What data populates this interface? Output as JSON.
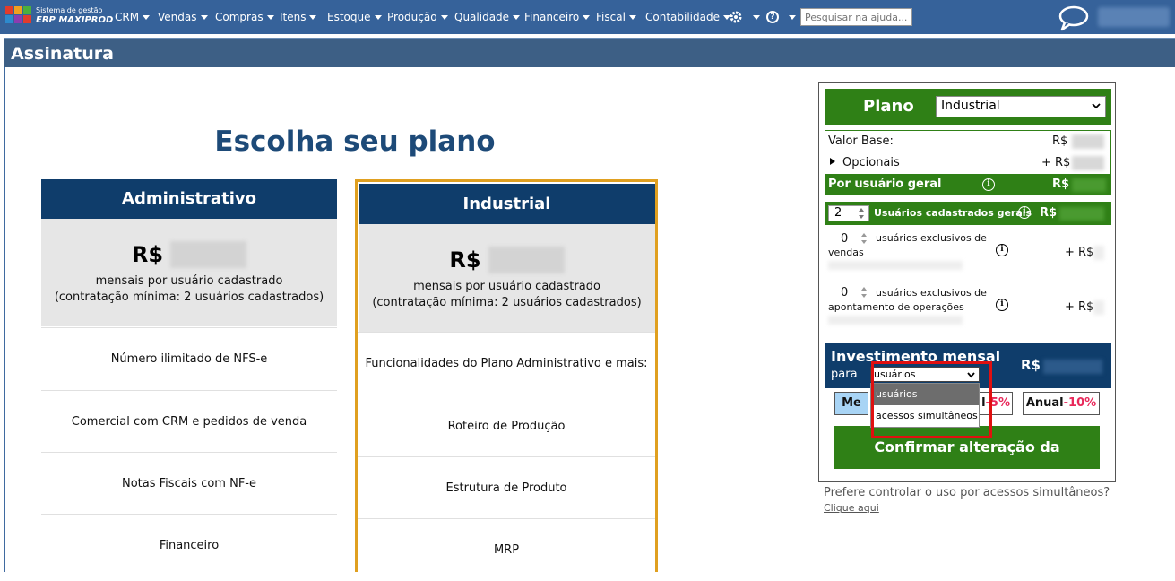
{
  "topbar": {
    "brand_line1": "Sistema de gestão",
    "brand_line2": "ERP MAXIPROD",
    "menu": [
      {
        "label": "CRM"
      },
      {
        "label": "Vendas"
      },
      {
        "label": "Compras"
      },
      {
        "label": "Itens"
      },
      {
        "label": "Estoque"
      },
      {
        "label": "Produção"
      },
      {
        "label": "Qualidade"
      },
      {
        "label": "Financeiro"
      },
      {
        "label": "Fiscal"
      },
      {
        "label": "Contabilidade"
      }
    ],
    "search_placeholder": "Pesquisar na ajuda...",
    "nav_color": "#36629a"
  },
  "page": {
    "title": "Assinatura",
    "heading": "Escolha seu plano"
  },
  "plans": [
    {
      "name": "Administrativo",
      "currency": "R$",
      "price_note_1": "mensais por usuário cadastrado",
      "price_note_2": "(contratação mínima: 2 usuários cadastrados)",
      "features": [
        "Número ilimitado de NFS-e",
        "Comercial com CRM e pedidos de venda",
        "Notas Fiscais com NF-e",
        "Financeiro"
      ]
    },
    {
      "name": "Industrial",
      "currency": "R$",
      "price_note_1": "mensais por usuário cadastrado",
      "price_note_2": "(contratação mínima: 2 usuários cadastrados)",
      "features": [
        "Funcionalidades do Plano Administrativo e mais:",
        "Roteiro de Produção",
        "Estrutura de Produto",
        "MRP"
      ]
    }
  ],
  "panel": {
    "plano_label": "Plano",
    "plano_value": "Industrial",
    "valor_base_label": "Valor Base:",
    "valor_base_currency": "R$",
    "opcionais_label": "Opcionais",
    "opcionais_currency": "+ R$",
    "por_usuario_label": "Por usuário geral",
    "por_usuario_currency": "R$",
    "usuarios_gerais_count": "2",
    "usuarios_gerais_label": "Usuários cadastrados gerais",
    "usuarios_gerais_currency": "R$",
    "vendas_count": "0",
    "vendas_label_1": "usuários exclusivos de",
    "vendas_label_2": "vendas",
    "vendas_currency": "+ R$",
    "apont_count": "0",
    "apont_label_1": "usuários exclusivos de",
    "apont_label_2": "apontamento de operações",
    "apont_currency": "+ R$",
    "invest_label": "Investimento mensal",
    "invest_para": "para",
    "invest_currency": "R$",
    "invest_select_value": "usuários cadastrados",
    "invest_options": [
      "usuários cadastrados",
      "acessos simultâneos"
    ],
    "btn_mensal_partial": "Me",
    "btn_semestral_partial": "l",
    "btn_semestral_discount": "-5%",
    "btn_anual": "Anual",
    "btn_anual_discount": "-10%",
    "confirm_label": "Confirmar alteração da assinatura",
    "below_text": "Prefere controlar o uso por acessos simultâneos?",
    "below_link": "Clique aqui"
  },
  "colors": {
    "green": "#2f8016",
    "navy": "#0f3d6b",
    "highlight": "#e01010",
    "discount": "#e8285a",
    "gold_border": "#e0a020"
  }
}
